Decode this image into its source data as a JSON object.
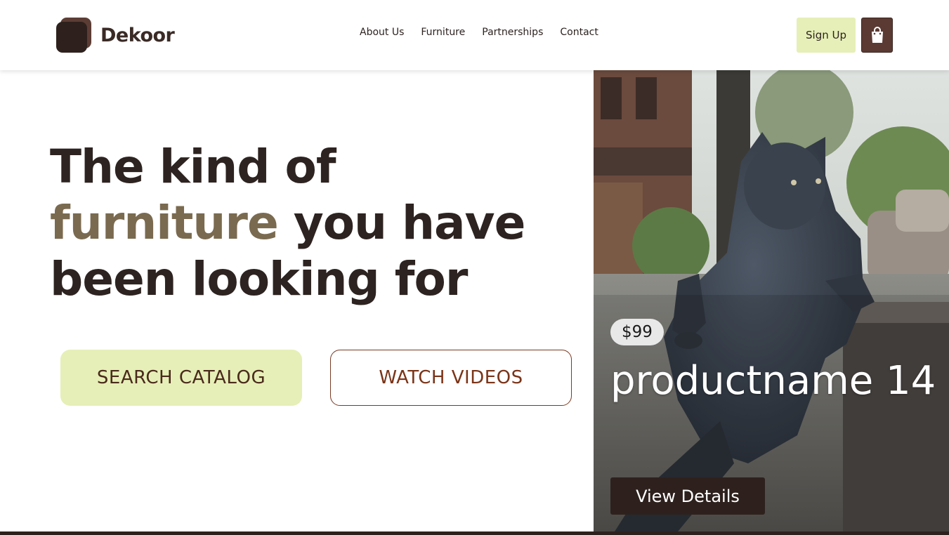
{
  "brand": {
    "name": "Dekoor"
  },
  "nav": {
    "links": [
      "About Us",
      "Furniture",
      "Partnerships",
      "Contact"
    ]
  },
  "header": {
    "signup_label": "Sign Up",
    "cart_icon": "shopping-bag-icon"
  },
  "hero": {
    "title_line1": "The kind of",
    "title_accent": "furniture",
    "title_line2_rest": " you have",
    "title_line3": "been looking for",
    "search_button": "SEARCH CATALOG",
    "watch_button": "WATCH VIDEOS"
  },
  "product": {
    "price": "$99",
    "name": "productname 14",
    "details_button": "View Details"
  },
  "colors": {
    "dark_brown": "#2e211d",
    "accent_olive": "#7a6a4f",
    "lime": "#e6efb7",
    "rust": "#7a3418"
  }
}
